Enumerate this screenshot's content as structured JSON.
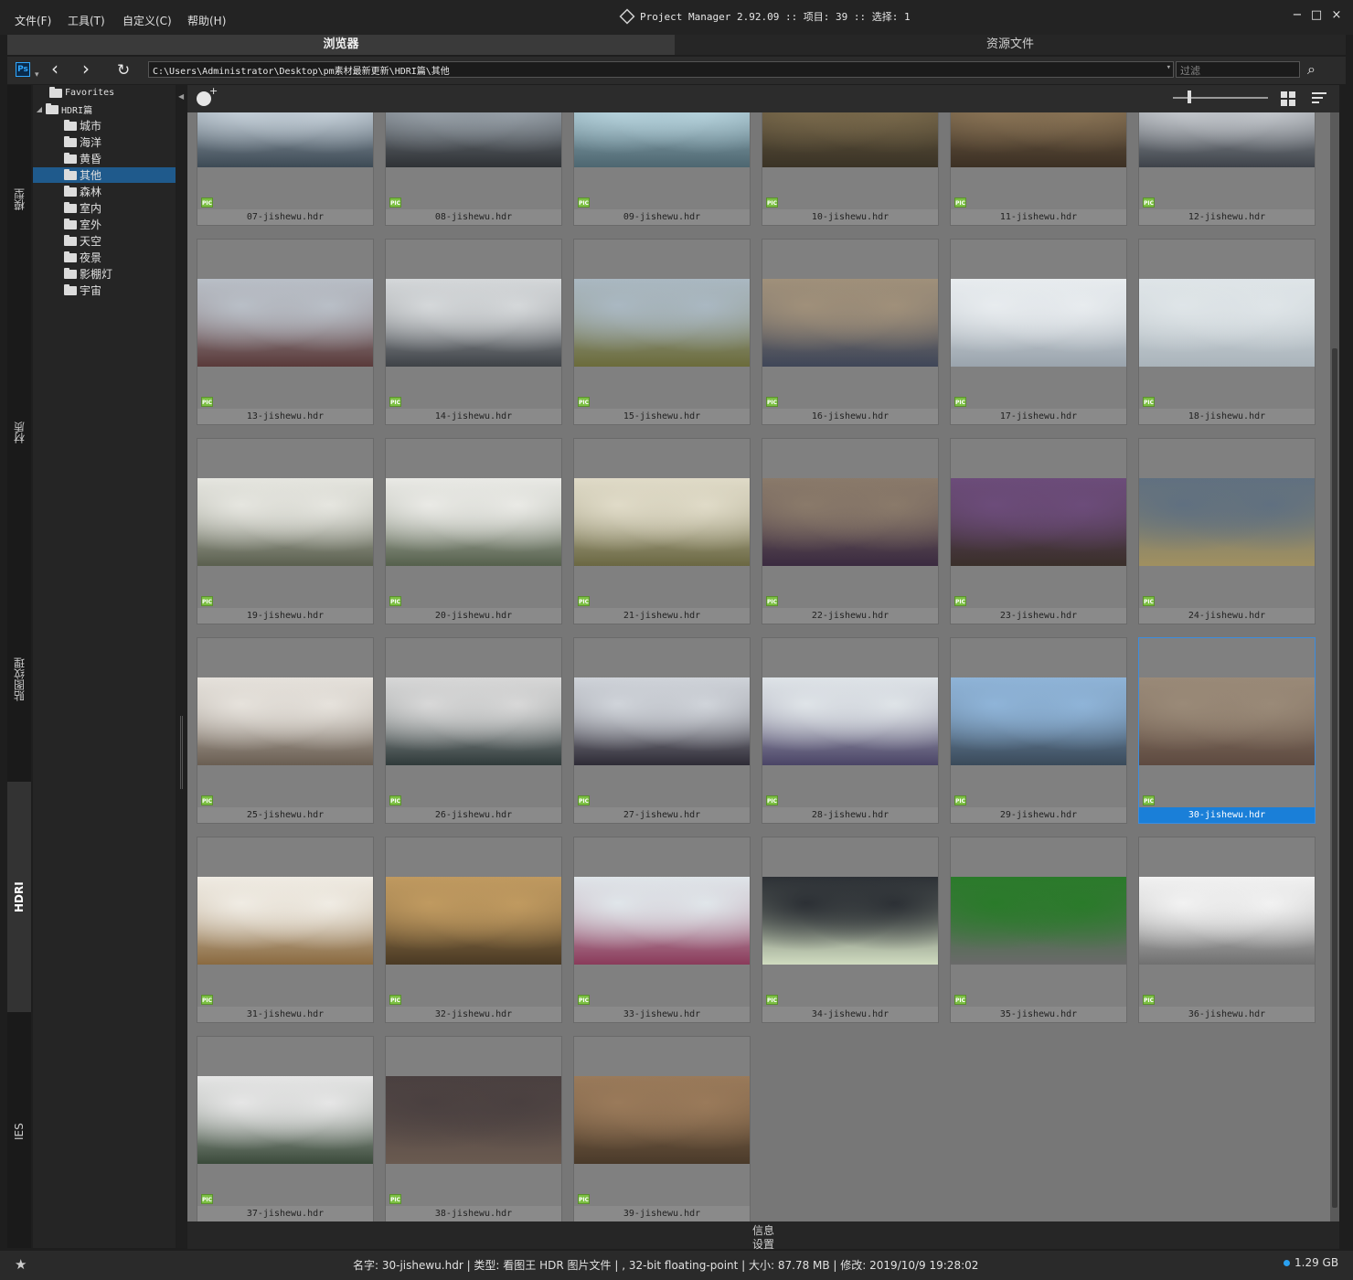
{
  "menu": {
    "file": "文件(F)",
    "tools": "工具(T)",
    "customize": "自定义(C)",
    "help": "帮助(H)"
  },
  "app": {
    "title": "Project Manager 2.92.09  :: 项目: 39  :: 选择: 1"
  },
  "window_controls": {
    "minimize": "−",
    "maximize": "□",
    "close": "×"
  },
  "tabs": {
    "browser": "浏览器",
    "assets": "资源文件"
  },
  "address": {
    "ps_label": "Ps",
    "path": "C:\\Users\\Administrator\\Desktop\\pm素材最新更新\\HDRI篇\\其他",
    "filter_placeholder": "过滤"
  },
  "side_tabs": [
    "模型",
    "材质",
    "贴图纹理",
    "HDRI",
    "IES"
  ],
  "active_side_tab": "HDRI",
  "tree": {
    "favorites": "Favorites",
    "root": "HDRI篇",
    "folders": [
      "城市",
      "海洋",
      "黄昏",
      "其他",
      "森林",
      "室内",
      "室外",
      "天空",
      "夜景",
      "影棚灯",
      "宇宙"
    ],
    "selected": "其他"
  },
  "files": {
    "badge": "PIC",
    "items": [
      "07-jishewu.hdr",
      "08-jishewu.hdr",
      "09-jishewu.hdr",
      "10-jishewu.hdr",
      "11-jishewu.hdr",
      "12-jishewu.hdr",
      "13-jishewu.hdr",
      "14-jishewu.hdr",
      "15-jishewu.hdr",
      "16-jishewu.hdr",
      "17-jishewu.hdr",
      "18-jishewu.hdr",
      "19-jishewu.hdr",
      "20-jishewu.hdr",
      "21-jishewu.hdr",
      "22-jishewu.hdr",
      "23-jishewu.hdr",
      "24-jishewu.hdr",
      "25-jishewu.hdr",
      "26-jishewu.hdr",
      "27-jishewu.hdr",
      "28-jishewu.hdr",
      "29-jishewu.hdr",
      "30-jishewu.hdr",
      "31-jishewu.hdr",
      "32-jishewu.hdr",
      "33-jishewu.hdr",
      "34-jishewu.hdr",
      "35-jishewu.hdr",
      "36-jishewu.hdr",
      "37-jishewu.hdr",
      "38-jishewu.hdr",
      "39-jishewu.hdr"
    ],
    "selected": "30-jishewu.hdr",
    "thumb_colors": [
      [
        "#c8d3dc",
        "#3d4a55"
      ],
      [
        "#9aa3ab",
        "#2f3236"
      ],
      [
        "#b8d5df",
        "#4d6670"
      ],
      [
        "#7a6a4c",
        "#3a3326"
      ],
      [
        "#8a7456",
        "#3c3024"
      ],
      [
        "#c7cbd0",
        "#3e434a"
      ],
      [
        "#b9bfc7",
        "#5a3a3a"
      ],
      [
        "#d5d8da",
        "#3e4247"
      ],
      [
        "#aab8c2",
        "#6b6b3a"
      ],
      [
        "#a0907a",
        "#3f4658"
      ],
      [
        "#e8ecef",
        "#9aa4ad"
      ],
      [
        "#dfe5e8",
        "#aab4bb"
      ],
      [
        "#e6e6e0",
        "#5a5f4e"
      ],
      [
        "#eaeae6",
        "#55604c"
      ],
      [
        "#e0dbc8",
        "#6a6742"
      ],
      [
        "#8a7a6a",
        "#3a2a40"
      ],
      [
        "#6c4c7a",
        "#3a2f2a"
      ],
      [
        "#607080",
        "#a09060"
      ],
      [
        "#e6e2dc",
        "#6a5e52"
      ],
      [
        "#d8d8d8",
        "#2f3a3a"
      ],
      [
        "#d0d4da",
        "#2e2b36"
      ],
      [
        "#dfe4e8",
        "#4a4466"
      ],
      [
        "#8fb4d8",
        "#3a4a5a"
      ],
      [
        "#9a8a78",
        "#5e4a40"
      ],
      [
        "#f0ece4",
        "#8a6a40"
      ],
      [
        "#c09a60",
        "#4a3a24"
      ],
      [
        "#e0e6ea",
        "#8a3a5a"
      ],
      [
        "#2c3035",
        "#d0dcc0"
      ],
      [
        "#2a7a2a",
        "#6a6a6a"
      ],
      [
        "#f2f2f2",
        "#707070"
      ],
      [
        "#e6e6e6",
        "#3a4a3a"
      ],
      [
        "#4a4040",
        "#6a5a50"
      ],
      [
        "#9a7a5a",
        "#4a3a2a"
      ]
    ]
  },
  "bottom_panel": {
    "info": "信息",
    "settings": "设置"
  },
  "status": {
    "text": "名字: 30-jishewu.hdr | 类型: 看图王 HDR 图片文件 | , 32-bit floating-point | 大小: 87.78 MB | 修改: 2019/10/9 19:28:02",
    "disk": "1.29 GB",
    "accent": "#1a7fd8"
  }
}
